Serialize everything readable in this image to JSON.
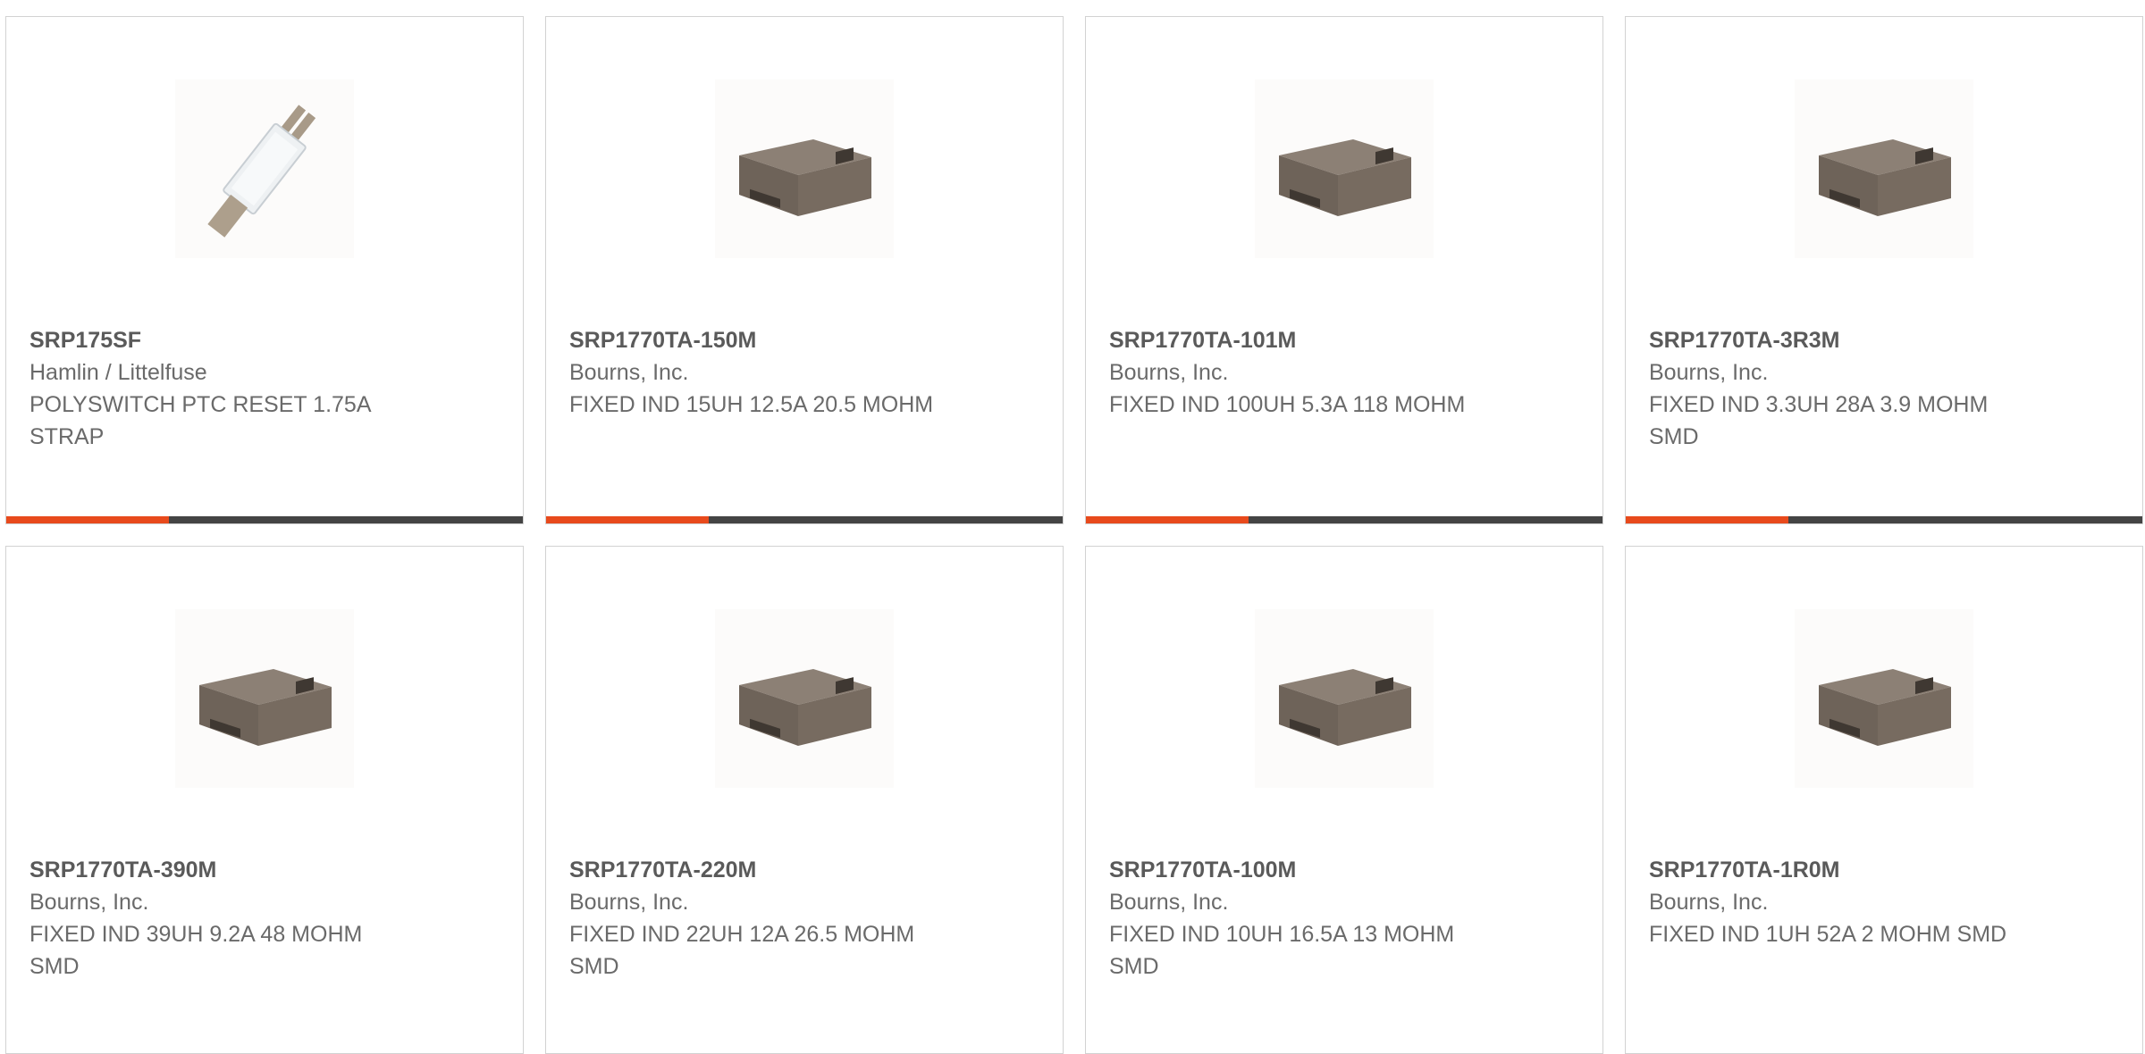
{
  "products": [
    {
      "part_number": "SRP175SF",
      "manufacturer": "Hamlin / Littelfuse",
      "description": "POLYSWITCH PTC RESET 1.75A STRAP",
      "image_icon": "ptc-strap-image",
      "accent_color": "#e84a1c"
    },
    {
      "part_number": "SRP1770TA-150M",
      "manufacturer": "Bourns, Inc.",
      "description": "FIXED IND 15UH 12.5A 20.5 MOHM",
      "image_icon": "smd-inductor-image",
      "accent_color": "#e84a1c"
    },
    {
      "part_number": "SRP1770TA-101M",
      "manufacturer": "Bourns, Inc.",
      "description": "FIXED IND 100UH 5.3A 118 MOHM",
      "image_icon": "smd-inductor-image",
      "accent_color": "#e84a1c"
    },
    {
      "part_number": "SRP1770TA-3R3M",
      "manufacturer": "Bourns, Inc.",
      "description": "FIXED IND 3.3UH 28A 3.9 MOHM SMD",
      "image_icon": "smd-inductor-image",
      "accent_color": "#e84a1c"
    },
    {
      "part_number": "SRP1770TA-390M",
      "manufacturer": "Bourns, Inc.",
      "description": "FIXED IND 39UH 9.2A 48 MOHM SMD",
      "image_icon": "smd-inductor-image"
    },
    {
      "part_number": "SRP1770TA-220M",
      "manufacturer": "Bourns, Inc.",
      "description": "FIXED IND 22UH 12A 26.5 MOHM SMD",
      "image_icon": "smd-inductor-image"
    },
    {
      "part_number": "SRP1770TA-100M",
      "manufacturer": "Bourns, Inc.",
      "description": "FIXED IND 10UH 16.5A 13 MOHM SMD",
      "image_icon": "smd-inductor-image"
    },
    {
      "part_number": "SRP1770TA-1R0M",
      "manufacturer": "Bourns, Inc.",
      "description": "FIXED IND 1UH 52A 2 MOHM SMD",
      "image_icon": "smd-inductor-image"
    }
  ]
}
